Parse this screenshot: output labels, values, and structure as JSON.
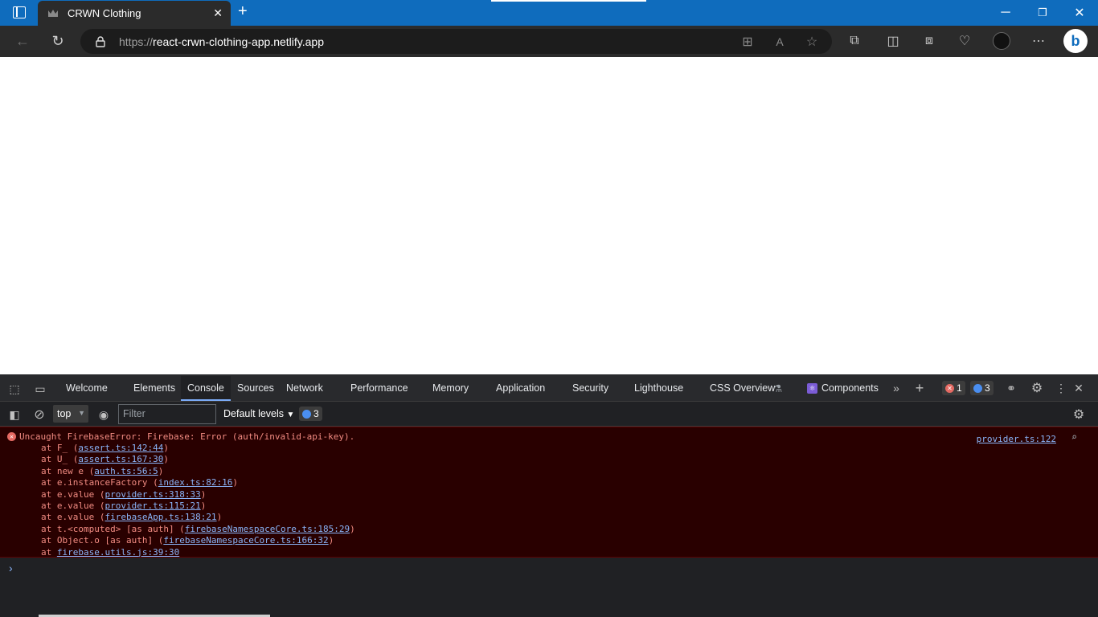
{
  "browser": {
    "tab_title": "CRWN Clothing",
    "new_tab": "+",
    "url_scheme": "https://",
    "url_host": "react-crwn-clothing-app.netlify.app"
  },
  "devtools": {
    "tabs": [
      "Welcome",
      "Elements",
      "Console",
      "Sources",
      "Network",
      "Performance",
      "Memory",
      "Application",
      "Security",
      "Lighthouse",
      "CSS Overview",
      "Components"
    ],
    "active_tab": "Console",
    "error_count": "1",
    "message_count": "3",
    "context": "top",
    "filter_placeholder": "Filter",
    "levels": "Default levels",
    "filter_message_count": "3"
  },
  "console": {
    "error_message": "Uncaught FirebaseError: Firebase: Error (auth/invalid-api-key).",
    "error_source": "provider.ts:122",
    "stack": [
      {
        "prefix": "at F_ (",
        "link": "assert.ts:142:44",
        "suffix": ")"
      },
      {
        "prefix": "at U_ (",
        "link": "assert.ts:167:30",
        "suffix": ")"
      },
      {
        "prefix": "at new e (",
        "link": "auth.ts:56:5",
        "suffix": ")"
      },
      {
        "prefix": "at e.instanceFactory (",
        "link": "index.ts:82:16",
        "suffix": ")"
      },
      {
        "prefix": "at e.value (",
        "link": "provider.ts:318:33",
        "suffix": ")"
      },
      {
        "prefix": "at e.value (",
        "link": "provider.ts:115:21",
        "suffix": ")"
      },
      {
        "prefix": "at e.value (",
        "link": "firebaseApp.ts:138:21",
        "suffix": ")"
      },
      {
        "prefix": "at t.<computed> [as auth] (",
        "link": "firebaseNamespaceCore.ts:185:29",
        "suffix": ")"
      },
      {
        "prefix": "at Object.o [as auth] (",
        "link": "firebaseNamespaceCore.ts:166:32",
        "suffix": ")"
      },
      {
        "prefix": "at ",
        "link": "firebase.utils.js:39:30",
        "suffix": ""
      }
    ]
  },
  "colors": {
    "titlebar": "#0f6cbd",
    "toolbar": "#2b2b2b",
    "error_bg": "#290000",
    "error_text": "#f28b82",
    "link": "#8ab4f8"
  }
}
